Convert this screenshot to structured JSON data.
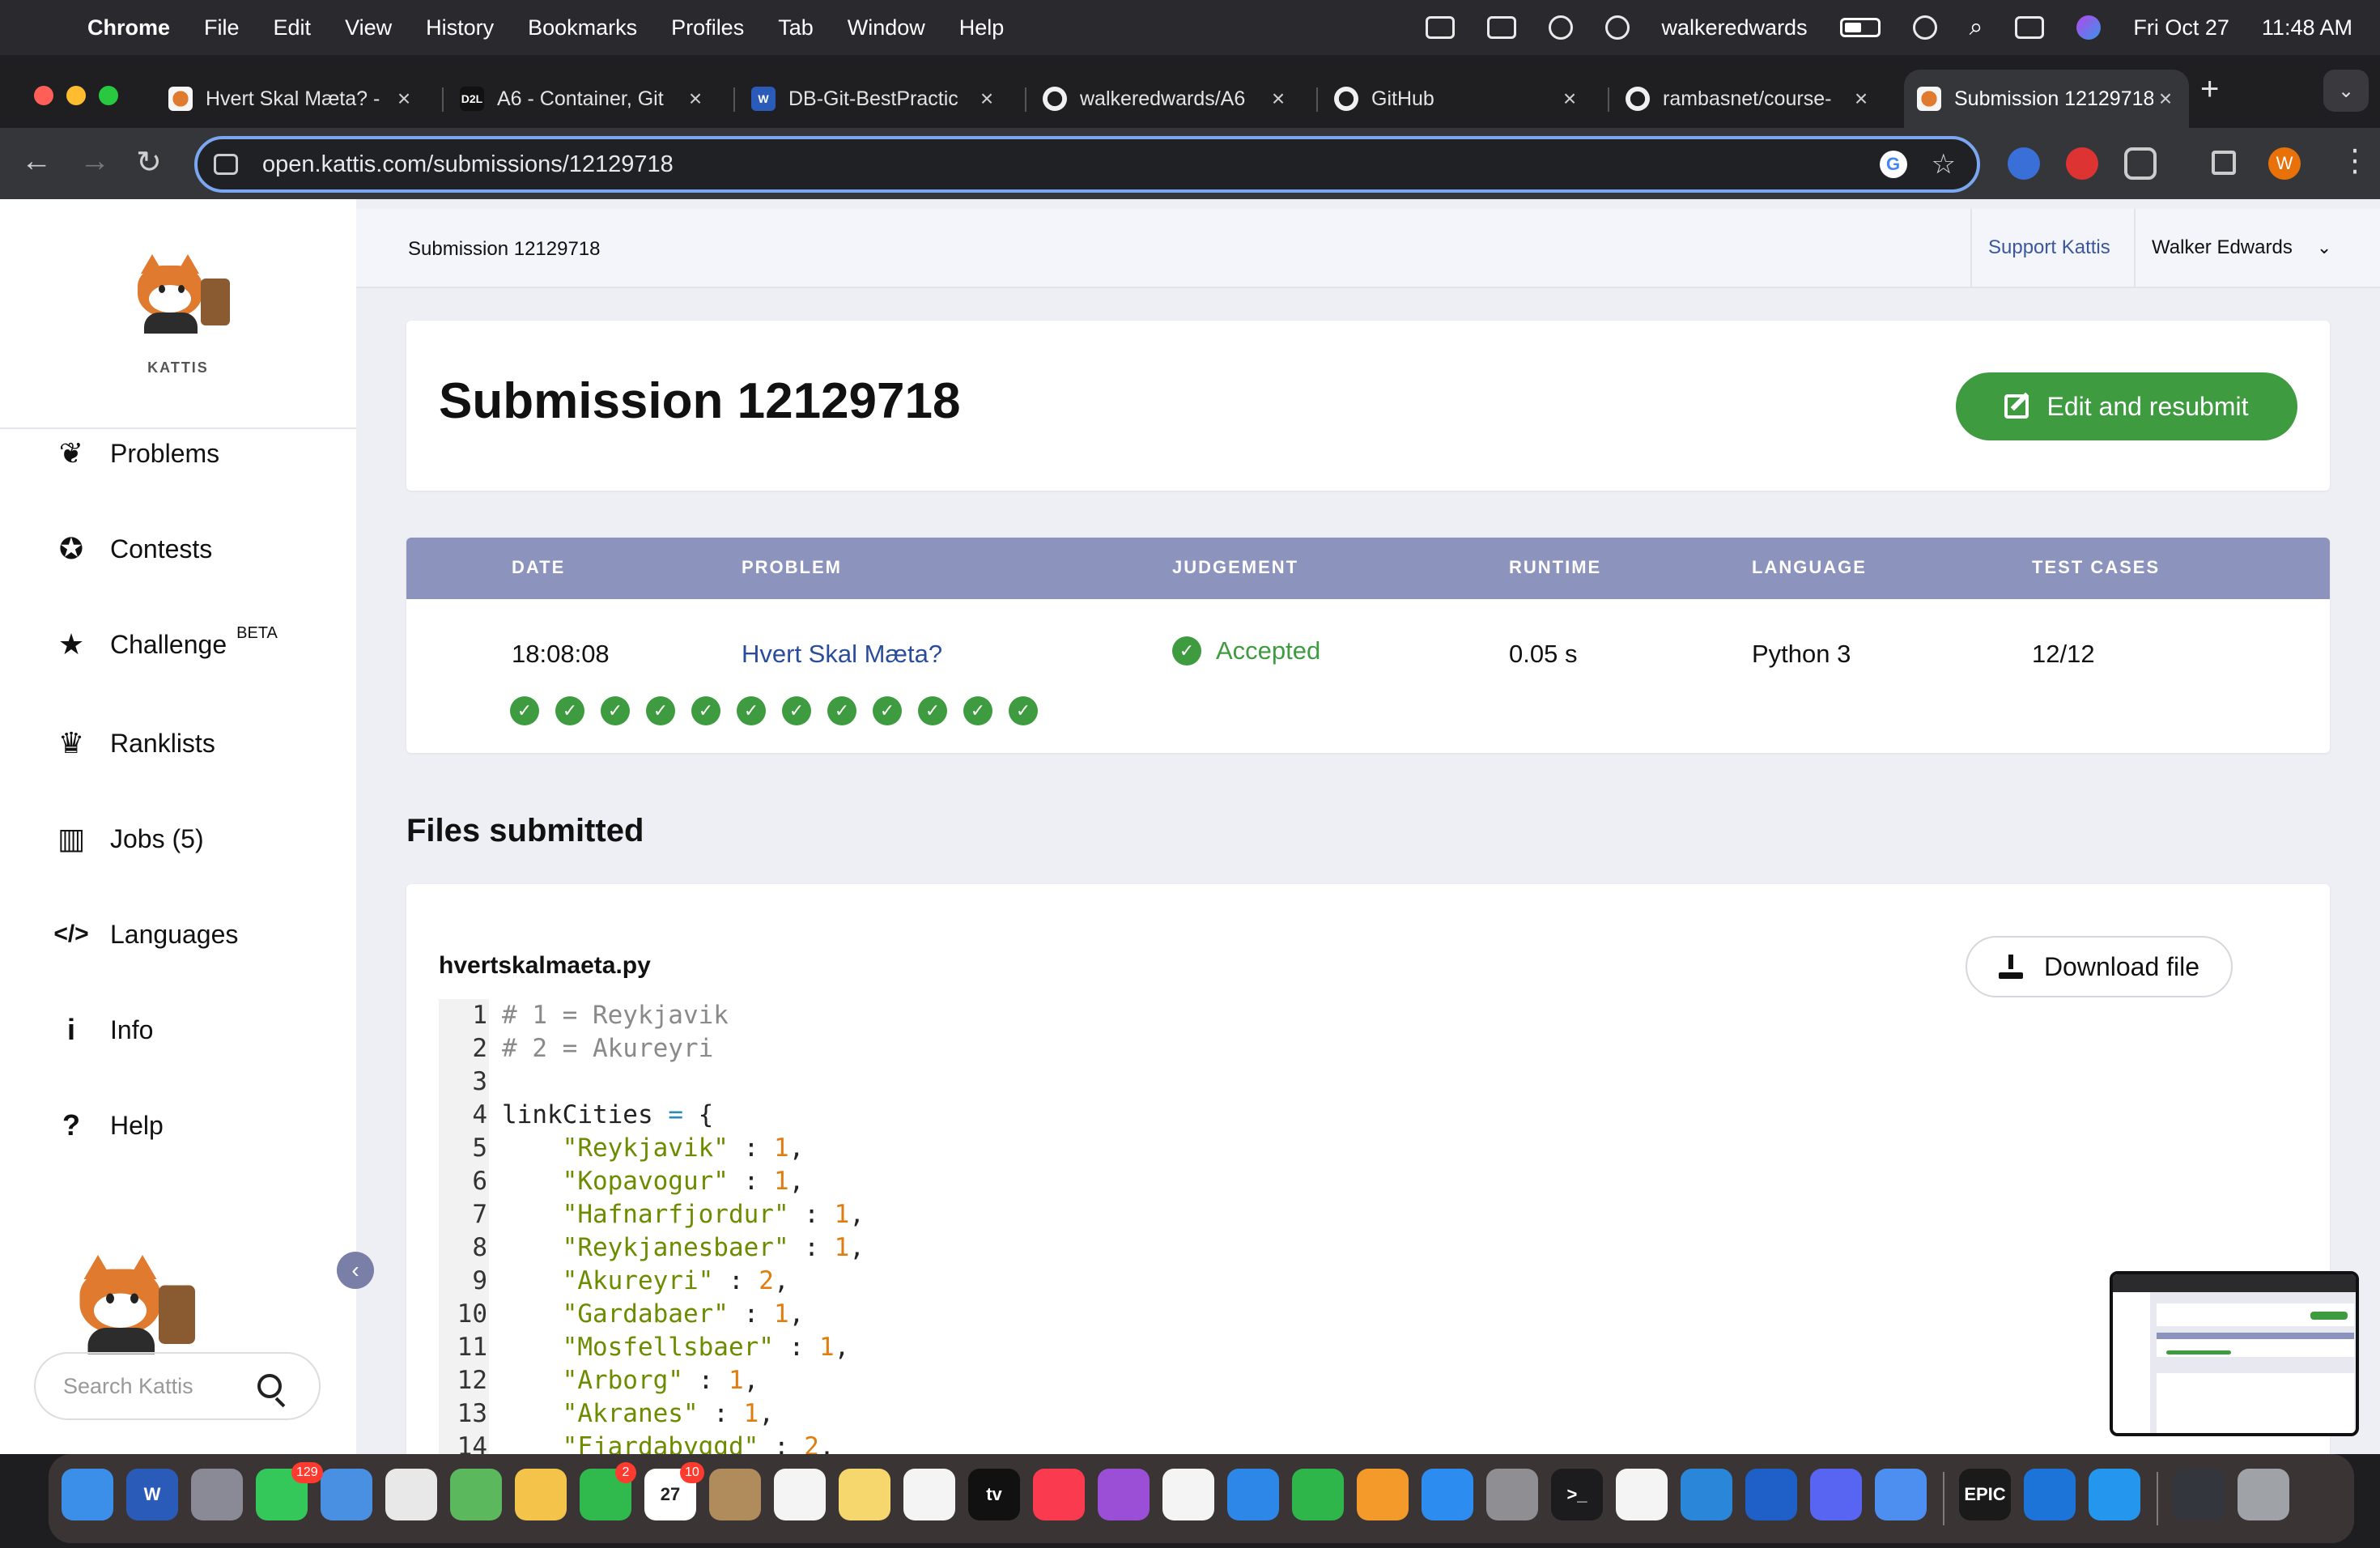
{
  "menubar": {
    "app": "Chrome",
    "items": [
      "File",
      "Edit",
      "View",
      "History",
      "Bookmarks",
      "Profiles",
      "Tab",
      "Window",
      "Help"
    ],
    "username": "walkeredwards",
    "date": "Fri Oct 27",
    "time": "11:48 AM"
  },
  "tabs": [
    {
      "label": "Hvert Skal Mæta? - ",
      "icon": "kattis-icon"
    },
    {
      "label": "A6 - Container, Git",
      "icon": "d2l-icon",
      "icon_text": "D2L"
    },
    {
      "label": "DB-Git-BestPractic",
      "icon": "word-icon",
      "icon_text": "W"
    },
    {
      "label": "walkeredwards/A6",
      "icon": "github-icon"
    },
    {
      "label": "GitHub",
      "icon": "github-icon"
    },
    {
      "label": "rambasnet/course-",
      "icon": "github-icon"
    },
    {
      "label": "Submission 12129718",
      "icon": "kattis-icon",
      "active": true
    }
  ],
  "address": {
    "url": "open.kattis.com/submissions/12129718"
  },
  "header": {
    "breadcrumb": "Submission 12129718",
    "support": "Support Kattis",
    "user": "Walker Edwards"
  },
  "sidebar": {
    "brand": "KATTIS",
    "items": [
      {
        "label": "Problems",
        "icon": "brain-icon"
      },
      {
        "label": "Contests",
        "icon": "award-icon"
      },
      {
        "label": "Challenge",
        "icon": "star-icon",
        "sup": "BETA"
      },
      {
        "label": "Ranklists",
        "icon": "trophy-icon"
      },
      {
        "label": "Jobs (5)",
        "icon": "briefcase-icon"
      },
      {
        "label": "Languages",
        "icon": "code-icon"
      },
      {
        "label": "Info",
        "icon": "info-icon"
      },
      {
        "label": "Help",
        "icon": "help-icon"
      }
    ],
    "search_placeholder": "Search Kattis"
  },
  "submission": {
    "title": "Submission 12129718",
    "edit_button": "Edit and resubmit",
    "columns": [
      "DATE",
      "PROBLEM",
      "JUDGEMENT",
      "RUNTIME",
      "LANGUAGE",
      "TEST CASES"
    ],
    "row": {
      "date": "18:08:08",
      "problem": "Hvert Skal Mæta?",
      "judgement": "Accepted",
      "runtime": "0.05 s",
      "language": "Python 3",
      "test_cases": "12/12"
    },
    "test_cases_passed": 12
  },
  "files": {
    "heading": "Files submitted",
    "filename": "hvertskalmaeta.py",
    "download_button": "Download file",
    "code_lines": [
      [
        {
          "t": "# 1 = Reykjavik",
          "c": "c"
        }
      ],
      [
        {
          "t": "# 2 = Akureyri",
          "c": "c"
        }
      ],
      [],
      [
        {
          "t": "linkCities "
        },
        {
          "t": "=",
          "c": "o"
        },
        {
          "t": " {"
        }
      ],
      [
        {
          "t": "    "
        },
        {
          "t": "\"Reykjavik\"",
          "c": "s"
        },
        {
          "t": " : "
        },
        {
          "t": "1",
          "c": "n"
        },
        {
          "t": ","
        }
      ],
      [
        {
          "t": "    "
        },
        {
          "t": "\"Kopavogur\"",
          "c": "s"
        },
        {
          "t": " : "
        },
        {
          "t": "1",
          "c": "n"
        },
        {
          "t": ","
        }
      ],
      [
        {
          "t": "    "
        },
        {
          "t": "\"Hafnarfjordur\"",
          "c": "s"
        },
        {
          "t": " : "
        },
        {
          "t": "1",
          "c": "n"
        },
        {
          "t": ","
        }
      ],
      [
        {
          "t": "    "
        },
        {
          "t": "\"Reykjanesbaer\"",
          "c": "s"
        },
        {
          "t": " : "
        },
        {
          "t": "1",
          "c": "n"
        },
        {
          "t": ","
        }
      ],
      [
        {
          "t": "    "
        },
        {
          "t": "\"Akureyri\"",
          "c": "s"
        },
        {
          "t": " : "
        },
        {
          "t": "2",
          "c": "n"
        },
        {
          "t": ","
        }
      ],
      [
        {
          "t": "    "
        },
        {
          "t": "\"Gardabaer\"",
          "c": "s"
        },
        {
          "t": " : "
        },
        {
          "t": "1",
          "c": "n"
        },
        {
          "t": ","
        }
      ],
      [
        {
          "t": "    "
        },
        {
          "t": "\"Mosfellsbaer\"",
          "c": "s"
        },
        {
          "t": " : "
        },
        {
          "t": "1",
          "c": "n"
        },
        {
          "t": ","
        }
      ],
      [
        {
          "t": "    "
        },
        {
          "t": "\"Arborg\"",
          "c": "s"
        },
        {
          "t": " : "
        },
        {
          "t": "1",
          "c": "n"
        },
        {
          "t": ","
        }
      ],
      [
        {
          "t": "    "
        },
        {
          "t": "\"Akranes\"",
          "c": "s"
        },
        {
          "t": " : "
        },
        {
          "t": "1",
          "c": "n"
        },
        {
          "t": ","
        }
      ],
      [
        {
          "t": "    "
        },
        {
          "t": "\"Fjardabyggd\"",
          "c": "s"
        },
        {
          "t": " : "
        },
        {
          "t": "2",
          "c": "n"
        },
        {
          "t": ","
        }
      ]
    ]
  },
  "dock": {
    "apps": [
      {
        "name": "finder-icon",
        "color": "#3b8fe8"
      },
      {
        "name": "word-icon",
        "color": "#2b5bb8",
        "text": "W"
      },
      {
        "name": "launchpad-icon",
        "color": "#8a8a96"
      },
      {
        "name": "messages-icon",
        "color": "#34c759",
        "badge": "129"
      },
      {
        "name": "mail-icon",
        "color": "#4a90e2"
      },
      {
        "name": "chrome-icon",
        "color": "#e8e8e8"
      },
      {
        "name": "maps-icon",
        "color": "#5cb85c"
      },
      {
        "name": "photos-icon",
        "color": "#f3c34a"
      },
      {
        "name": "facetime-icon",
        "color": "#30b94d",
        "badge": "2"
      },
      {
        "name": "calendar-icon",
        "color": "#ffffff",
        "text": "27",
        "badge": "10"
      },
      {
        "name": "contacts-icon",
        "color": "#b08b5b"
      },
      {
        "name": "reminders-icon",
        "color": "#f4f4f4"
      },
      {
        "name": "notes-icon",
        "color": "#f5d76e"
      },
      {
        "name": "freeform-icon",
        "color": "#f4f4f4"
      },
      {
        "name": "appletv-icon",
        "color": "#111111",
        "text": "tv"
      },
      {
        "name": "music-icon",
        "color": "#fa3b4f"
      },
      {
        "name": "podcasts-icon",
        "color": "#9b4fd6"
      },
      {
        "name": "news-icon",
        "color": "#f4f4f4"
      },
      {
        "name": "keynote-icon",
        "color": "#2d87e8"
      },
      {
        "name": "numbers-icon",
        "color": "#2fb64a"
      },
      {
        "name": "pages-icon",
        "color": "#f39a2b"
      },
      {
        "name": "appstore-icon",
        "color": "#2d8cf0"
      },
      {
        "name": "settings-icon",
        "color": "#8e8e93"
      },
      {
        "name": "terminal-icon",
        "color": "#1c1c1e",
        "text": ">_"
      },
      {
        "name": "textedit-icon",
        "color": "#f4f4f4"
      },
      {
        "name": "vscode-icon",
        "color": "#2a86d8"
      },
      {
        "name": "1password-icon",
        "color": "#1f5fc8"
      },
      {
        "name": "discord-icon",
        "color": "#5865f2"
      },
      {
        "name": "arc-icon",
        "color": "#4d8ff0"
      },
      {
        "name": "epicgames-icon",
        "color": "#1a1a1a",
        "text": "EPIC"
      },
      {
        "name": "onedrive-icon",
        "color": "#1d74d8"
      },
      {
        "name": "docker-icon",
        "color": "#2496ed"
      },
      {
        "name": "window-preview-icon",
        "color": "#33363d"
      },
      {
        "name": "trash-icon",
        "color": "#9fa3a8"
      }
    ]
  },
  "colors": {
    "accent_orange": "#e5a83d",
    "success_green": "#3e9b40",
    "table_header": "#8c93bc",
    "link_blue": "#2a4d9b"
  }
}
